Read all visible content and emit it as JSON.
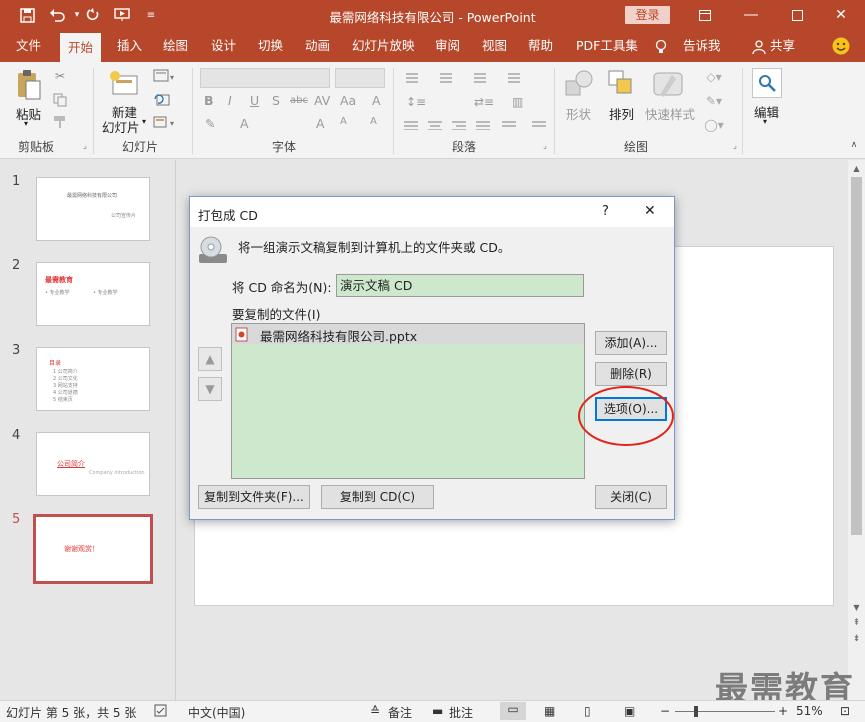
{
  "window": {
    "title": "最需网络科技有限公司  -  PowerPoint",
    "login": "登录"
  },
  "tabs": [
    "文件",
    "开始",
    "插入",
    "绘图",
    "设计",
    "切换",
    "动画",
    "幻灯片放映",
    "审阅",
    "视图",
    "帮助",
    "PDF工具集"
  ],
  "tell_me": "告诉我",
  "share": "共享",
  "ribbon": {
    "paste": "粘贴",
    "new_slide": "新建\n幻灯片",
    "new_slide_line1": "新建",
    "new_slide_line2": "幻灯片",
    "shapes": "形状",
    "arrange": "排列",
    "quick_styles": "快速样式",
    "edit": "编辑",
    "groups": {
      "clipboard": "剪贴板",
      "slides": "幻灯片",
      "font": "字体",
      "paragraph": "段落",
      "drawing": "绘图"
    }
  },
  "slides": [
    {
      "num": "1",
      "title": "最需网络科技有限公司",
      "sub": "公司宣传片"
    },
    {
      "num": "2",
      "title": "最需教育",
      "items": [
        "• 专业教学",
        "• 专业教学"
      ]
    },
    {
      "num": "3",
      "title": "目录",
      "items": [
        "1 公司简介",
        "2 公司文化",
        "3 网站支持",
        "4 公司道德",
        "5 结束页"
      ]
    },
    {
      "num": "4",
      "title": "公司简介",
      "sub": "Company introduction"
    },
    {
      "num": "5",
      "title": "谢谢观赏！"
    }
  ],
  "dialog": {
    "title": "打包成 CD",
    "help": "?",
    "close_x": "✕",
    "description": "将一组演示文稿复制到计算机上的文件夹或 CD。",
    "name_label": "将 CD 命名为(N):",
    "name_value": "演示文稿 CD",
    "files_label": "要复制的文件(I)",
    "files": [
      "最需网络科技有限公司.pptx"
    ],
    "buttons": {
      "add": "添加(A)...",
      "remove": "删除(R)",
      "options": "选项(O)...",
      "copy_folder": "复制到文件夹(F)...",
      "copy_cd": "复制到 CD(C)",
      "close": "关闭(C)"
    }
  },
  "status": {
    "slide_info": "幻灯片 第 5 张，共 5 张",
    "language": "中文(中国)",
    "notes": "备注",
    "comments": "批注",
    "zoom": "51%"
  },
  "watermark": "最需教育",
  "colors": {
    "accent": "#b7472a",
    "selection": "#c0504d",
    "highlight_circle": "#e2231a",
    "field_bg": "#cde8cd"
  }
}
